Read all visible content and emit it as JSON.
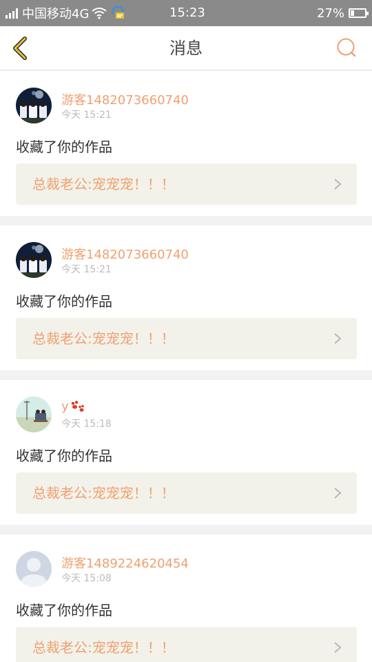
{
  "status": {
    "carrier": "中国移动4G",
    "time": "15:23",
    "battery_pct": "27%",
    "battery_level": 0.27,
    "icons": [
      "signal-icon",
      "wifi-icon",
      "notification-icon",
      "battery-icon"
    ]
  },
  "header": {
    "title": "消息",
    "back_icon": "back-chevron-icon",
    "search_icon": "search-icon"
  },
  "colors": {
    "accent": "#f0a070",
    "back_icon": "#d4a017",
    "card_bg": "#ffffff",
    "work_bg": "#f2f2ea"
  },
  "messages": [
    {
      "username": "游客1482073660740",
      "time": "今天 15:21",
      "action": "收藏了你的作品",
      "work_title": "总裁老公:宠宠宠！！！",
      "avatar": "group-photo-avatar"
    },
    {
      "username": "游客1482073660740",
      "time": "今天 15:21",
      "action": "收藏了你的作品",
      "work_title": "总裁老公:宠宠宠！！！",
      "avatar": "group-photo-avatar"
    },
    {
      "username": "y",
      "username_icon": "paw-icon",
      "time": "今天 15:18",
      "action": "收藏了你的作品",
      "work_title": "总裁老公:宠宠宠！！！",
      "avatar": "scenery-avatar"
    },
    {
      "username": "游客1489224620454",
      "time": "今天 15:08",
      "action": "收藏了你的作品",
      "work_title": "总裁老公:宠宠宠！！！",
      "avatar": "default-avatar"
    }
  ]
}
